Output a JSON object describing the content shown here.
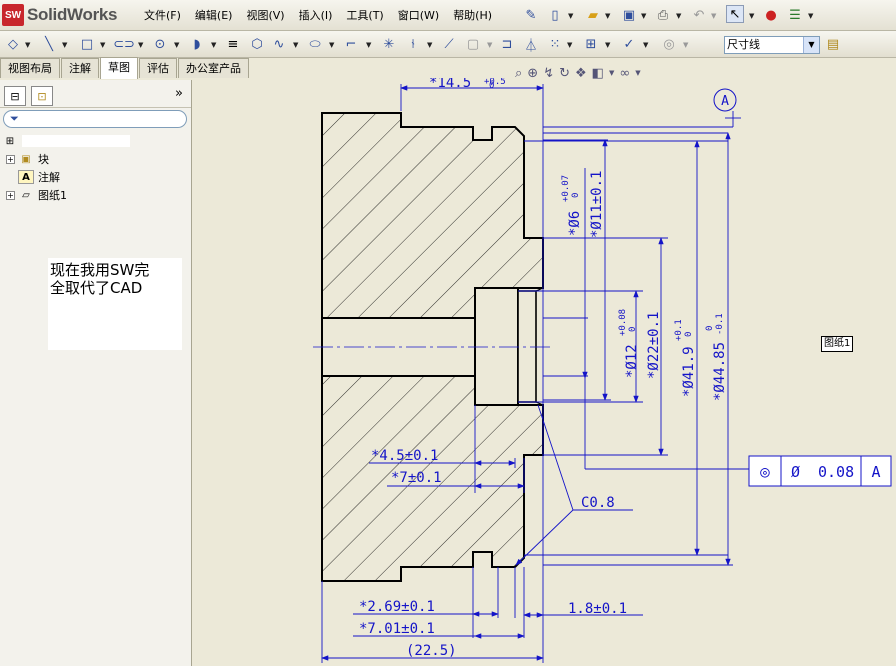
{
  "app": {
    "logo_text": "SolidWorks",
    "logo_mark": "SW"
  },
  "menu": {
    "items": [
      "文件(F)",
      "编辑(E)",
      "视图(V)",
      "插入(I)",
      "工具(T)",
      "窗口(W)",
      "帮助(H)"
    ]
  },
  "toolbar": {
    "layer_value": "尺寸线"
  },
  "tabs": {
    "items": [
      "视图布局",
      "注解",
      "草图",
      "评估",
      "办公室产品"
    ],
    "active_index": 2
  },
  "tree": {
    "items": [
      {
        "label": "块",
        "icon": "block-icon",
        "expandable": true
      },
      {
        "label": "注解",
        "icon": "annotation-icon",
        "expandable": false
      },
      {
        "label": "图纸1",
        "icon": "sheet-icon",
        "expandable": true
      }
    ]
  },
  "note": {
    "line1": "现在我用SW完",
    "line2": "全取代了CAD"
  },
  "sheet_label": "图纸1",
  "dimensions": {
    "d_14_5": "*14.5",
    "d_14_5_tol_upper": "+0.5",
    "d_14_5_tol_lower": "0",
    "datum": "A",
    "d_phi6": "*Ø6",
    "d_phi6_tol_upper": "+0.07",
    "d_phi6_tol_lower": "0",
    "d_phi11": "*Ø11±0.1",
    "d_phi12": "*Ø12",
    "d_phi12_tol_upper": "+0.08",
    "d_phi12_tol_lower": "0",
    "d_phi22": "*Ø22±0.1",
    "d_phi41_9": "*Ø41.9",
    "d_phi41_9_tol_upper": "+0.1",
    "d_phi41_9_tol_lower": "0",
    "d_phi44_85": "*Ø44.85",
    "d_phi44_85_tol_upper": "0",
    "d_phi44_85_tol_lower": "-0.1",
    "d_4_5": "*4.5±0.1",
    "d_7": "*7±0.1",
    "chamfer": "C0.8",
    "d_2_69": "*2.69±0.1",
    "d_7_01": "*7.01±0.1",
    "d_22_5": "(22.5)",
    "d_1_8": "1.8±0.1"
  },
  "gdt": {
    "symbol": "◎",
    "diameter": "Ø",
    "tolerance": "0.08",
    "datum": "A"
  },
  "colors": {
    "dimension": "#1414C8",
    "outline": "#000000",
    "brand": "#C8262C"
  }
}
